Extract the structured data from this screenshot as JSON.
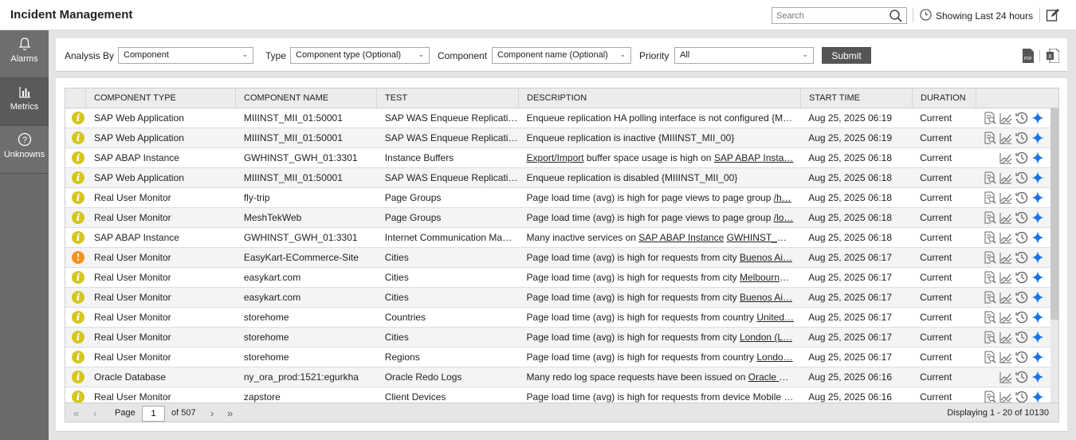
{
  "header": {
    "title": "Incident Management",
    "search_placeholder": "Search",
    "showing": "Showing Last 24 hours"
  },
  "sidebar": {
    "items": [
      {
        "label": "Alarms"
      },
      {
        "label": "Metrics"
      },
      {
        "label": "Unknowns"
      }
    ]
  },
  "filter": {
    "analysis_label": "Analysis By",
    "analysis_value": "Component",
    "type_label": "Type",
    "type_value": "Component type (Optional)",
    "component_label": "Component",
    "component_value": "Component name (Optional)",
    "priority_label": "Priority",
    "priority_value": "All",
    "submit": "Submit"
  },
  "table": {
    "headers": [
      "COMPONENT TYPE",
      "COMPONENT NAME",
      "TEST",
      "DESCRIPTION",
      "START TIME",
      "DURATION"
    ],
    "rows": [
      {
        "sev": "info",
        "type": "SAP Web Application",
        "name": "MIIINST_MII_01:50001",
        "test": "SAP WAS Enqueue Replicati…",
        "desc": [
          {
            "t": "Enqueue replication HA polling interface is not configured {M…"
          }
        ],
        "start": "Aug 25, 2025 06:19",
        "dur": "Current",
        "detail": true
      },
      {
        "sev": "info",
        "type": "SAP Web Application",
        "name": "MIIINST_MII_01:50001",
        "test": "SAP WAS Enqueue Replicati…",
        "desc": [
          {
            "t": "Enqueue replication is inactive {MIIINST_MII_00}"
          }
        ],
        "start": "Aug 25, 2025 06:19",
        "dur": "Current",
        "detail": true
      },
      {
        "sev": "info",
        "type": "SAP ABAP Instance",
        "name": "GWHINST_GWH_01:3301",
        "test": "Instance Buffers",
        "desc": [
          {
            "t": "Export/Import",
            "u": true
          },
          {
            "t": " buffer space usage is high on "
          },
          {
            "t": "SAP ABAP Insta…",
            "u": true
          }
        ],
        "start": "Aug 25, 2025 06:18",
        "dur": "Current",
        "detail": false
      },
      {
        "sev": "info",
        "type": "SAP Web Application",
        "name": "MIIINST_MII_01:50001",
        "test": "SAP WAS Enqueue Replicati…",
        "desc": [
          {
            "t": "Enqueue replication is disabled {MIIINST_MII_00}"
          }
        ],
        "start": "Aug 25, 2025 06:18",
        "dur": "Current",
        "detail": true
      },
      {
        "sev": "info",
        "type": "Real User Monitor",
        "name": "fly-trip",
        "test": "Page Groups",
        "desc": [
          {
            "t": "Page load time (avg) is high for page views to page group "
          },
          {
            "t": "/h…",
            "u": true
          }
        ],
        "start": "Aug 25, 2025 06:18",
        "dur": "Current",
        "detail": true
      },
      {
        "sev": "info",
        "type": "Real User Monitor",
        "name": "MeshTekWeb",
        "test": "Page Groups",
        "desc": [
          {
            "t": "Page load time (avg) is high for page views to page group "
          },
          {
            "t": "/lo…",
            "u": true
          }
        ],
        "start": "Aug 25, 2025 06:18",
        "dur": "Current",
        "detail": true
      },
      {
        "sev": "info",
        "type": "SAP ABAP Instance",
        "name": "GWHINST_GWH_01:3301",
        "test": "Internet Communication Ma…",
        "desc": [
          {
            "t": "Many inactive services on "
          },
          {
            "t": "SAP ABAP Instance",
            "u": true
          },
          {
            "t": " "
          },
          {
            "t": "GWHINST_GW…",
            "u": true
          }
        ],
        "start": "Aug 25, 2025 06:18",
        "dur": "Current",
        "detail": true
      },
      {
        "sev": "major",
        "type": "Real User Monitor",
        "name": "EasyKart-ECommerce-Site",
        "test": "Cities",
        "desc": [
          {
            "t": "Page load time (avg) is high for requests from city "
          },
          {
            "t": "Buenos Ai…",
            "u": true
          }
        ],
        "start": "Aug 25, 2025 06:17",
        "dur": "Current",
        "detail": true
      },
      {
        "sev": "info",
        "type": "Real User Monitor",
        "name": "easykart.com",
        "test": "Cities",
        "desc": [
          {
            "t": "Page load time (avg) is high for requests from city "
          },
          {
            "t": "Melbourne…",
            "u": true
          }
        ],
        "start": "Aug 25, 2025 06:17",
        "dur": "Current",
        "detail": true
      },
      {
        "sev": "info",
        "type": "Real User Monitor",
        "name": "easykart.com",
        "test": "Cities",
        "desc": [
          {
            "t": "Page load time (avg) is high for requests from city "
          },
          {
            "t": "Buenos Ai…",
            "u": true
          }
        ],
        "start": "Aug 25, 2025 06:17",
        "dur": "Current",
        "detail": true
      },
      {
        "sev": "info",
        "type": "Real User Monitor",
        "name": "storehome",
        "test": "Countries",
        "desc": [
          {
            "t": "Page load time (avg) is high for requests from country "
          },
          {
            "t": "United…",
            "u": true
          }
        ],
        "start": "Aug 25, 2025 06:17",
        "dur": "Current",
        "detail": true
      },
      {
        "sev": "info",
        "type": "Real User Monitor",
        "name": "storehome",
        "test": "Cities",
        "desc": [
          {
            "t": "Page load time (avg) is high for requests from city "
          },
          {
            "t": "London (L…",
            "u": true
          }
        ],
        "start": "Aug 25, 2025 06:17",
        "dur": "Current",
        "detail": true
      },
      {
        "sev": "info",
        "type": "Real User Monitor",
        "name": "storehome",
        "test": "Regions",
        "desc": [
          {
            "t": "Page load time (avg) is high for requests from country "
          },
          {
            "t": "Londo…",
            "u": true
          }
        ],
        "start": "Aug 25, 2025 06:17",
        "dur": "Current",
        "detail": true
      },
      {
        "sev": "info",
        "type": "Oracle Database",
        "name": "ny_ora_prod:1521:egurkha",
        "test": "Oracle Redo Logs",
        "desc": [
          {
            "t": "Many redo log space requests have been issued on "
          },
          {
            "t": "Oracle D…",
            "u": true
          }
        ],
        "start": "Aug 25, 2025 06:16",
        "dur": "Current",
        "detail": false
      },
      {
        "sev": "info",
        "type": "Real User Monitor",
        "name": "zapstore",
        "test": "Client Devices",
        "desc": [
          {
            "t": "Page load time (avg) is high for requests from device Mobile …"
          }
        ],
        "start": "Aug 25, 2025 06:16",
        "dur": "Current",
        "detail": true
      }
    ]
  },
  "pagination": {
    "page_label": "Page",
    "page": "1",
    "of": "of 507",
    "displaying": "Displaying 1 - 20 of 10130"
  },
  "colors": {
    "info": "#d4c61e",
    "major": "#f5921e",
    "accent": "#1a73e8"
  }
}
